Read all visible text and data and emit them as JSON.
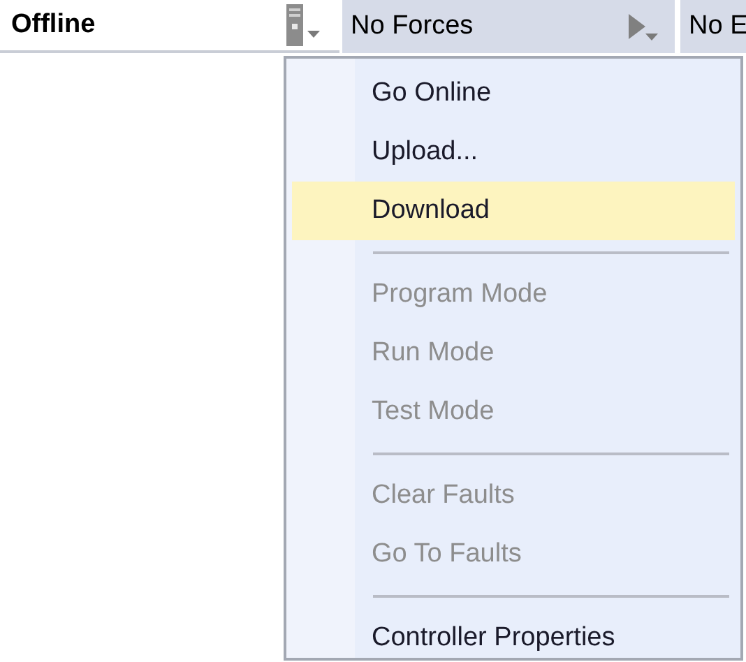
{
  "toolbar": [
    {
      "text": "Offline",
      "kind": "status"
    },
    {
      "text": "No Forces",
      "kind": "forces"
    },
    {
      "text": "No E",
      "kind": "plain"
    }
  ],
  "menu": {
    "items": [
      {
        "kind": "item",
        "label": "Go Online",
        "disabled": false,
        "selected": false
      },
      {
        "kind": "item",
        "label": "Upload...",
        "disabled": false,
        "selected": false
      },
      {
        "kind": "item",
        "label": "Download",
        "disabled": false,
        "selected": true
      },
      {
        "kind": "separator"
      },
      {
        "kind": "item",
        "label": "Program Mode",
        "disabled": true,
        "selected": false
      },
      {
        "kind": "item",
        "label": "Run Mode",
        "disabled": true,
        "selected": false
      },
      {
        "kind": "item",
        "label": "Test Mode",
        "disabled": true,
        "selected": false
      },
      {
        "kind": "separator"
      },
      {
        "kind": "item",
        "label": "Clear Faults",
        "disabled": true,
        "selected": false
      },
      {
        "kind": "item",
        "label": "Go To Faults",
        "disabled": true,
        "selected": false
      },
      {
        "kind": "separator"
      },
      {
        "kind": "item",
        "label": "Controller Properties",
        "disabled": false,
        "selected": false
      }
    ]
  }
}
